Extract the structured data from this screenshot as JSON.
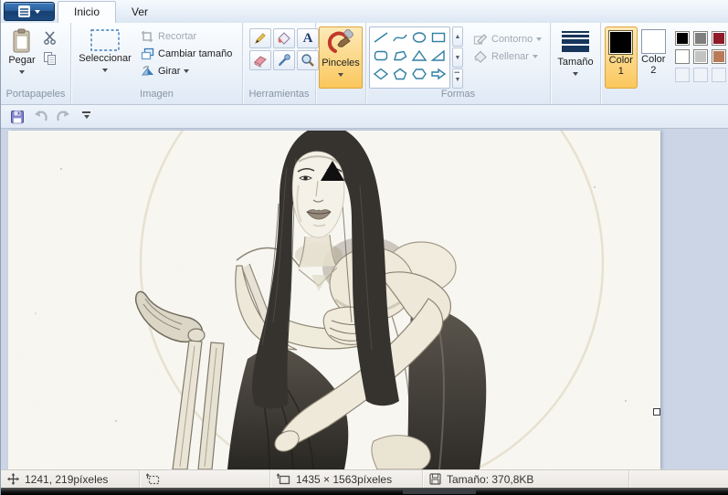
{
  "tabs": {
    "inicio": "Inicio",
    "ver": "Ver"
  },
  "ribbon": {
    "clipboard": {
      "label": "Portapapeles",
      "paste": "Pegar"
    },
    "image": {
      "label": "Imagen",
      "select": "Seleccionar",
      "crop": "Recortar",
      "resize": "Cambiar tamaño",
      "rotate": "Girar"
    },
    "tools": {
      "label": "Herramientas",
      "icons": [
        "pencil-icon",
        "fill-bucket-icon",
        "text-icon",
        "eraser-icon",
        "color-picker-icon",
        "magnifier-icon"
      ]
    },
    "brushes": {
      "label": "Pinceles",
      "selected": true
    },
    "shapes": {
      "label": "Formas",
      "outline": "Contorno",
      "fill": "Rellenar",
      "items": [
        "line",
        "curve",
        "ellipse",
        "rectangle",
        "rounded-rectangle",
        "polygon",
        "triangle",
        "right-triangle",
        "diamond",
        "pentagon",
        "hexagon",
        "arrow-right"
      ]
    },
    "size": {
      "label": "Tamaño"
    },
    "colors": {
      "color1": {
        "line1": "Color",
        "line2": "1",
        "value": "#000000",
        "selected": true
      },
      "color2": {
        "line1": "Color",
        "line2": "2",
        "value": "#ffffff",
        "selected": false
      },
      "selection_highlight": "#fbc75d",
      "palette": [
        [
          "#000000",
          "#7f7f7f",
          "#8e1a2a"
        ],
        [
          "#ffffff",
          "#c3c3c3",
          "#b97a57"
        ],
        [
          "",
          "",
          ""
        ]
      ]
    }
  },
  "quick_access": {
    "icons": [
      "save-icon",
      "undo-icon",
      "redo-icon",
      "customize-toolbar-icon"
    ]
  },
  "canvas": {
    "description": "Pencil sketch of a woman with long dark hair sitting on a wooden chair hugging her knees; a solid black triangle is drawn over her left eye; faint circle outline in the background"
  },
  "status": {
    "cursor": "1241, 219píxeles",
    "selection": "",
    "canvas_size": "1435 × 1563píxeles",
    "file_size": "Tamaño: 370,8KB"
  }
}
